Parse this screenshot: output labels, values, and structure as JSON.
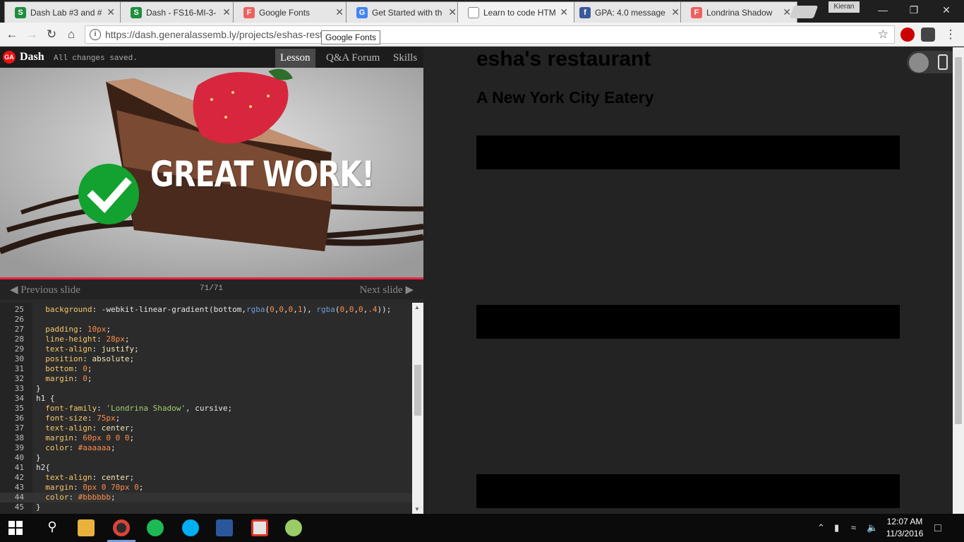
{
  "browser": {
    "tabs": [
      {
        "title": "Dash Lab #3 and #",
        "favicon": "S",
        "favicon_color": "#1e8e3e"
      },
      {
        "title": "Dash - FS16-MI-3-",
        "favicon": "S",
        "favicon_color": "#1e8e3e"
      },
      {
        "title": "Google Fonts",
        "favicon": "F",
        "favicon_color": "#f06060"
      },
      {
        "title": "Get Started with th",
        "favicon": "G",
        "favicon_color": "#4285f4"
      },
      {
        "title": "Learn to code HTM",
        "favicon": "",
        "favicon_color": "#ffffff"
      },
      {
        "title": "GPA: 4.0 message",
        "favicon": "f",
        "favicon_color": "#3b5998"
      },
      {
        "title": "Londrina Shadow",
        "favicon": "F",
        "favicon_color": "#f06060"
      }
    ],
    "active_tab": 4,
    "profile": "Kieran",
    "url": "https://dash.generalassemb.ly/projects/eshas-rest",
    "tooltip": "Google Fonts"
  },
  "dash": {
    "logo": "GA",
    "title": "Dash",
    "status": "All changes saved.",
    "tabs": [
      "Lesson",
      "Q&A Forum",
      "Skills"
    ],
    "active_tab": "Lesson",
    "hero_text": "GREAT WORK!",
    "prev_label": "Previous slide",
    "next_label": "Next slide",
    "counter": "71/71"
  },
  "editor": {
    "lines": [
      {
        "n": "25",
        "tokens": [
          [
            "  ",
            ""
          ],
          [
            "background",
            "p"
          ],
          [
            ": -webkit-linear-gradient(bottom,",
            ""
          ],
          [
            "rgba",
            "f"
          ],
          [
            "(",
            ""
          ],
          [
            "0",
            "n"
          ],
          [
            ",",
            ""
          ],
          [
            "0",
            "n"
          ],
          [
            ",",
            ""
          ],
          [
            "0",
            "n"
          ],
          [
            ",",
            ""
          ],
          [
            "1",
            "n"
          ],
          [
            "), ",
            ""
          ],
          [
            "rgba",
            "f"
          ],
          [
            "(",
            ""
          ],
          [
            "0",
            "n"
          ],
          [
            ",",
            ""
          ],
          [
            "0",
            "n"
          ],
          [
            ",",
            ""
          ],
          [
            "0",
            "n"
          ],
          [
            ",",
            ""
          ],
          [
            ".4",
            "n"
          ],
          [
            "));",
            ""
          ]
        ]
      },
      {
        "n": "26",
        "tokens": []
      },
      {
        "n": "27",
        "tokens": [
          [
            "  ",
            ""
          ],
          [
            "padding",
            "p"
          ],
          [
            ": ",
            ""
          ],
          [
            "10px",
            "n"
          ],
          [
            ";",
            ""
          ]
        ]
      },
      {
        "n": "28",
        "tokens": [
          [
            "  ",
            ""
          ],
          [
            "line-height",
            "p"
          ],
          [
            ": ",
            ""
          ],
          [
            "28px",
            "n"
          ],
          [
            ";",
            ""
          ]
        ]
      },
      {
        "n": "29",
        "tokens": [
          [
            "  ",
            ""
          ],
          [
            "text-align",
            "p"
          ],
          [
            ": ",
            ""
          ],
          [
            "justify",
            "v"
          ],
          [
            ";",
            ""
          ]
        ]
      },
      {
        "n": "30",
        "tokens": [
          [
            "  ",
            ""
          ],
          [
            "position",
            "p"
          ],
          [
            ": ",
            ""
          ],
          [
            "absolute",
            "v"
          ],
          [
            ";",
            ""
          ]
        ]
      },
      {
        "n": "31",
        "tokens": [
          [
            "  ",
            ""
          ],
          [
            "bottom",
            "p"
          ],
          [
            ": ",
            ""
          ],
          [
            "0",
            "n"
          ],
          [
            ";",
            ""
          ]
        ]
      },
      {
        "n": "32",
        "tokens": [
          [
            "  ",
            ""
          ],
          [
            "margin",
            "p"
          ],
          [
            ": ",
            ""
          ],
          [
            "0",
            "n"
          ],
          [
            ";",
            ""
          ]
        ]
      },
      {
        "n": "33",
        "tokens": [
          [
            "}",
            ""
          ]
        ]
      },
      {
        "n": "34",
        "tokens": [
          [
            "h1 {",
            ""
          ]
        ]
      },
      {
        "n": "35",
        "tokens": [
          [
            "  ",
            ""
          ],
          [
            "font-family",
            "p"
          ],
          [
            ": ",
            ""
          ],
          [
            "'Londrina Shadow'",
            "s"
          ],
          [
            ", cursive;",
            ""
          ]
        ]
      },
      {
        "n": "36",
        "tokens": [
          [
            "  ",
            ""
          ],
          [
            "font-size",
            "p"
          ],
          [
            ": ",
            ""
          ],
          [
            "75px",
            "n"
          ],
          [
            ";",
            ""
          ]
        ]
      },
      {
        "n": "37",
        "tokens": [
          [
            "  ",
            ""
          ],
          [
            "text-align",
            "p"
          ],
          [
            ": ",
            ""
          ],
          [
            "center",
            "v"
          ],
          [
            ";",
            ""
          ]
        ]
      },
      {
        "n": "38",
        "tokens": [
          [
            "  ",
            ""
          ],
          [
            "margin",
            "p"
          ],
          [
            ": ",
            ""
          ],
          [
            "60px 0 0 0",
            "n"
          ],
          [
            ";",
            ""
          ]
        ]
      },
      {
        "n": "39",
        "tokens": [
          [
            "  ",
            ""
          ],
          [
            "color",
            "p"
          ],
          [
            ": ",
            ""
          ],
          [
            "#aaaaaa",
            "n"
          ],
          [
            ";",
            ""
          ]
        ]
      },
      {
        "n": "40",
        "tokens": [
          [
            "}",
            ""
          ]
        ]
      },
      {
        "n": "41",
        "tokens": [
          [
            "h2{",
            ""
          ]
        ]
      },
      {
        "n": "42",
        "tokens": [
          [
            "  ",
            ""
          ],
          [
            "text-align",
            "p"
          ],
          [
            ": ",
            ""
          ],
          [
            "center",
            "v"
          ],
          [
            ";",
            ""
          ]
        ]
      },
      {
        "n": "43",
        "tokens": [
          [
            "  ",
            ""
          ],
          [
            "margin",
            "p"
          ],
          [
            ": ",
            ""
          ],
          [
            "0px 0 70px 0",
            "n"
          ],
          [
            ";",
            ""
          ]
        ]
      },
      {
        "n": "44",
        "tokens": [
          [
            "  ",
            ""
          ],
          [
            "color",
            "p"
          ],
          [
            ": ",
            ""
          ],
          [
            "#bbbbbb",
            "n"
          ],
          [
            ";",
            ""
          ]
        ]
      },
      {
        "n": "45",
        "tokens": [
          [
            "}",
            ""
          ]
        ]
      }
    ],
    "highlighted_line": "44"
  },
  "preview": {
    "h1": "esha's restaurant",
    "h2": "A New York City Eatery"
  },
  "taskbar": {
    "time": "12:07 AM",
    "date": "11/3/2016"
  }
}
